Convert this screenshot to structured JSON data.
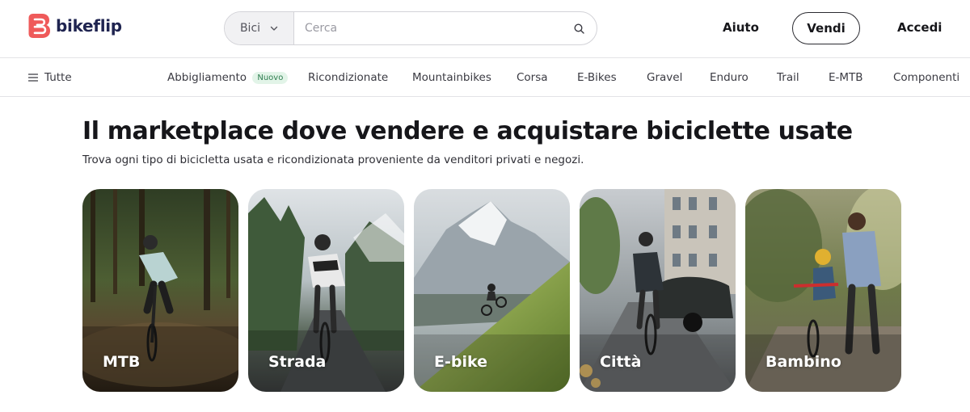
{
  "brand": {
    "name": "bikeflip",
    "logo_icon": "bikeflip-logo-icon",
    "accent": "#ef5a5a",
    "navy": "#1f2450"
  },
  "search": {
    "category": "Bici",
    "placeholder": "Cerca",
    "icon": "search-icon"
  },
  "header": {
    "help": "Aiuto",
    "sell": "Vendi",
    "login": "Accedi"
  },
  "nav": {
    "all": "Tutte",
    "menu_icon": "menu-icon",
    "items": [
      {
        "label": "Abbigliamento",
        "badge": "Nuovo"
      },
      {
        "label": "Ricondizionate"
      },
      {
        "label": "Mountainbikes"
      },
      {
        "label": "Corsa"
      },
      {
        "label": "E-Bikes"
      },
      {
        "label": "Gravel"
      },
      {
        "label": "Enduro"
      },
      {
        "label": "Trail"
      },
      {
        "label": "E-MTB"
      },
      {
        "label": "Componenti"
      }
    ]
  },
  "hero": {
    "title": "Il marketplace dove vendere e acquistare biciclette usate",
    "subtitle": "Trova ogni tipo di bicicletta usata e ricondizionata proveniente da venditori privati e negozi."
  },
  "categories": [
    {
      "label": "MTB"
    },
    {
      "label": "Strada"
    },
    {
      "label": "E-bike"
    },
    {
      "label": "Città"
    },
    {
      "label": "Bambino"
    }
  ]
}
